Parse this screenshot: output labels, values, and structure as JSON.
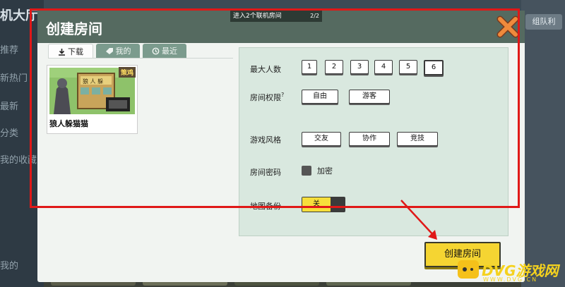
{
  "background": {
    "lobby_title": "机大厅",
    "left_menu": [
      "推荐",
      "新热门",
      "最新",
      "分类",
      "我的收藏",
      "我的"
    ],
    "team_button": "组队利"
  },
  "dialog": {
    "title": "创建房间",
    "room_tab": {
      "label": "进入2个联机房间",
      "counter": "2/2"
    },
    "tabs": [
      {
        "label": "下载",
        "icon": "download-icon",
        "active": true
      },
      {
        "label": "我的",
        "icon": "tag-icon",
        "active": false
      },
      {
        "label": "最近",
        "icon": "history-icon",
        "active": false
      }
    ],
    "map_card": {
      "name": "狼人躲猫猫",
      "tag": "策鸡",
      "sign": "狼 人 躲"
    },
    "settings": {
      "max_players": {
        "label": "最大人数",
        "options": [
          "1",
          "2",
          "3",
          "4",
          "5",
          "6"
        ],
        "selected": "6"
      },
      "permission": {
        "label": "房间权限",
        "help": "?",
        "options": [
          "自由",
          "游客"
        ]
      },
      "style": {
        "label": "游戏风格",
        "options": [
          "交友",
          "协作",
          "竞技"
        ]
      },
      "password": {
        "label": "房间密码",
        "checkbox_label": "加密",
        "checked": false
      },
      "backup": {
        "label": "地图备份",
        "toggle_label": "关",
        "on": false
      }
    },
    "create_button": "创建房间"
  },
  "watermark": {
    "brand": "DVG游戏网",
    "sub": "WWW.DVG.CN"
  },
  "colors": {
    "accent": "#f5d532",
    "header": "#556a60",
    "annotation": "#e01818"
  }
}
